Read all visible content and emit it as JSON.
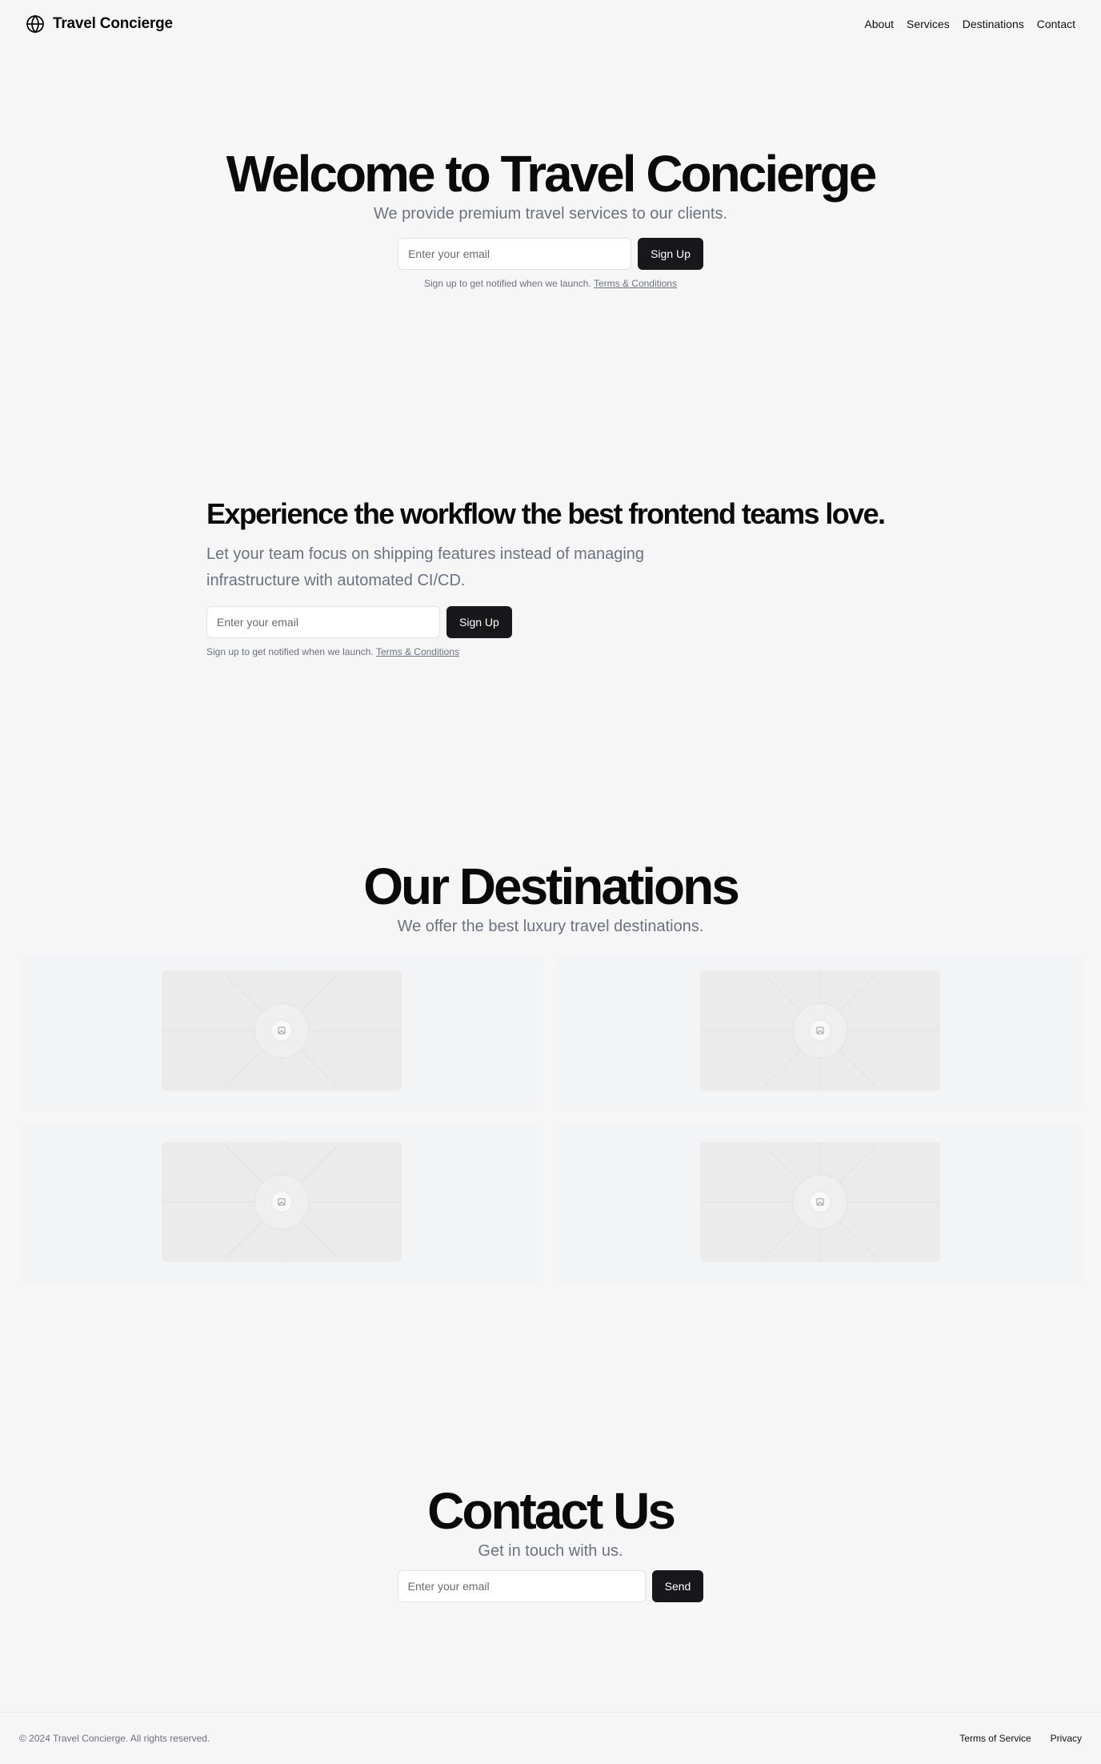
{
  "header": {
    "brand_name": "Travel Concierge",
    "nav": [
      {
        "label": "About"
      },
      {
        "label": "Services"
      },
      {
        "label": "Destinations"
      },
      {
        "label": "Contact"
      }
    ]
  },
  "hero": {
    "title": "Welcome to Travel Concierge",
    "subtitle": "We provide premium travel services to our clients.",
    "email_placeholder": "Enter your email",
    "button_label": "Sign Up",
    "note_text": "Sign up to get notified when we launch.",
    "terms_link": "Terms & Conditions"
  },
  "workflow": {
    "title": "Experience the workflow the best frontend teams love.",
    "text": "Let your team focus on shipping features instead of managing infrastructure with automated CI/CD.",
    "email_placeholder": "Enter your email",
    "button_label": "Sign Up",
    "note_text": "Sign up to get notified when we launch.",
    "terms_link": "Terms & Conditions"
  },
  "destinations": {
    "title": "Our Destinations",
    "subtitle": "We offer the best luxury travel destinations.",
    "cards": [
      {
        "icon": "image-placeholder-icon"
      },
      {
        "icon": "image-placeholder-icon"
      },
      {
        "icon": "image-placeholder-icon"
      },
      {
        "icon": "image-placeholder-icon"
      }
    ]
  },
  "contact": {
    "title": "Contact Us",
    "subtitle": "Get in touch with us.",
    "email_placeholder": "Enter your email",
    "button_label": "Send"
  },
  "footer": {
    "copyright": "© 2024 Travel Concierge. All rights reserved.",
    "links": [
      {
        "label": "Terms of Service"
      },
      {
        "label": "Privacy"
      }
    ]
  },
  "colors": {
    "background": "#f6f6f6",
    "button": "#18181b",
    "muted_text": "#6b7280",
    "card": "#f3f4f5",
    "image_placeholder": "#ebebeb"
  }
}
